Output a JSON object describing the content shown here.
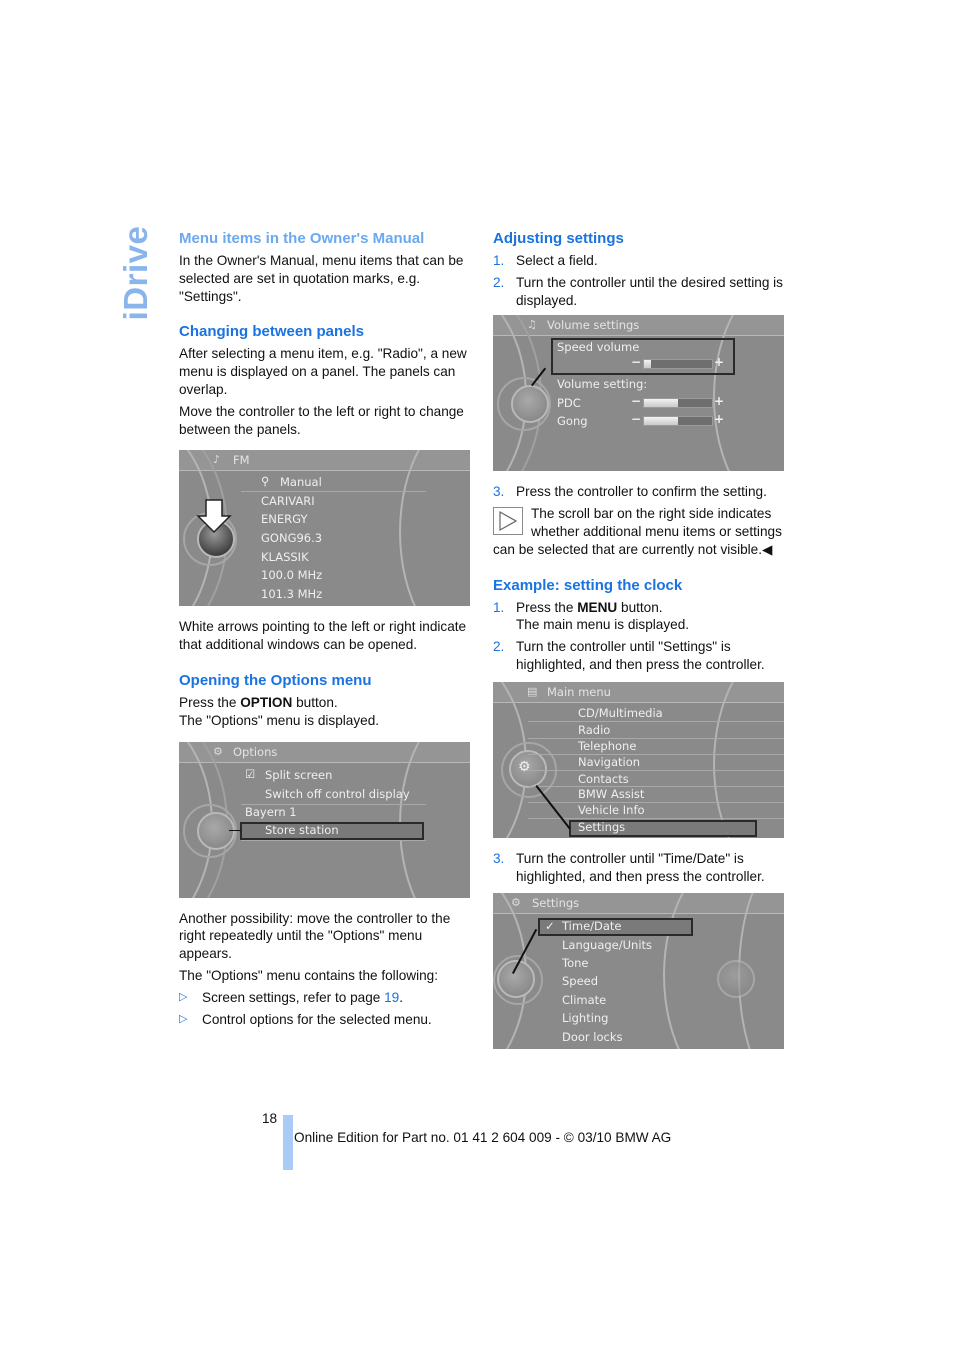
{
  "side_tab": "iDrive",
  "left_column": {
    "s1_heading": "Menu items in the Owner's Manual",
    "s1_text": "In the Owner's Manual, menu items that can be selected are set in quotation marks, e.g. \"Settings\".",
    "s2_heading": "Changing between panels",
    "s2_p1": "After selecting a menu item, e.g. \"Radio\", a new menu is displayed on a panel. The panels can overlap.",
    "s2_p2": "Move the controller to the left or right to change between the panels.",
    "fm_screen": {
      "title": "FM",
      "search_item": "Manual",
      "items": [
        "CARIVARI",
        "ENERGY",
        "GONG96.3",
        "KLASSIK",
        "100.0 MHz",
        "101.3 MHz"
      ]
    },
    "s2_p3": "White arrows pointing to the left or right indicate that additional windows can be opened.",
    "s3_heading": "Opening the Options menu",
    "s3_p1_pre": "Press the ",
    "s3_p1_bold": "OPTION",
    "s3_p1_post": " button.",
    "s3_p2": "The \"Options\" menu is displayed.",
    "options_screen": {
      "title": "Options",
      "items": [
        "Split screen",
        "Switch off control display"
      ],
      "group": "Bayern 1",
      "selected": "Store station"
    },
    "s3_p3": "Another possibility: move the controller to the right repeatedly until the \"Options\" menu appears.",
    "s3_p4": "The \"Options\" menu contains the following:",
    "bullets": [
      {
        "pre": "Screen settings, refer to page ",
        "link": "19",
        "post": "."
      },
      {
        "pre": "Control options for the selected menu.",
        "link": "",
        "post": ""
      }
    ]
  },
  "right_column": {
    "s1_heading": "Adjusting settings",
    "steps_a": [
      {
        "n": "1.",
        "text": "Select a field."
      },
      {
        "n": "2.",
        "text": "Turn the controller until the desired setting is displayed."
      }
    ],
    "volume_screen": {
      "title": "Volume settings",
      "selected": "Speed volume",
      "group": "Volume setting:",
      "sliders": [
        {
          "label": "Speed volume",
          "level": 0.1
        },
        {
          "label": "PDC",
          "level": 0.5
        },
        {
          "label": "Gong",
          "level": 0.5
        }
      ]
    },
    "step_a3": {
      "n": "3.",
      "text": "Press the controller to confirm the setting."
    },
    "note": "The scroll bar on the right side indicates whether additional menu items or settings can be selected that are currently not visible.",
    "note_end": "◀",
    "s2_heading": "Example: setting the clock",
    "step_b1": {
      "n": "1.",
      "pre": "Press the ",
      "bold": "MENU",
      "post": " button.",
      "line2": "The main menu is displayed."
    },
    "step_b2": {
      "n": "2.",
      "text": "Turn the controller until \"Settings\" is highlighted, and then press the controller."
    },
    "main_menu_screen": {
      "title": "Main menu",
      "items": [
        "CD/Multimedia",
        "Radio",
        "Telephone",
        "Navigation",
        "Contacts",
        "BMW Assist",
        "Vehicle Info"
      ],
      "selected": "Settings"
    },
    "step_b3": {
      "n": "3.",
      "text": "Turn the controller until \"Time/Date\" is highlighted, and then press the controller."
    },
    "settings_screen": {
      "title": "Settings",
      "selected": "Time/Date",
      "items": [
        "Language/Units",
        "Tone",
        "Speed",
        "Climate",
        "Lighting",
        "Door locks"
      ]
    }
  },
  "footer": {
    "page_number": "18",
    "edition": "Online Edition for Part no. 01 41 2 604 009 - © 03/10 BMW AG"
  },
  "colors": {
    "heading_blue": "#1a73e0",
    "side_tab_blue": "#8ab4ec",
    "footer_bar": "#a9cbf5"
  }
}
